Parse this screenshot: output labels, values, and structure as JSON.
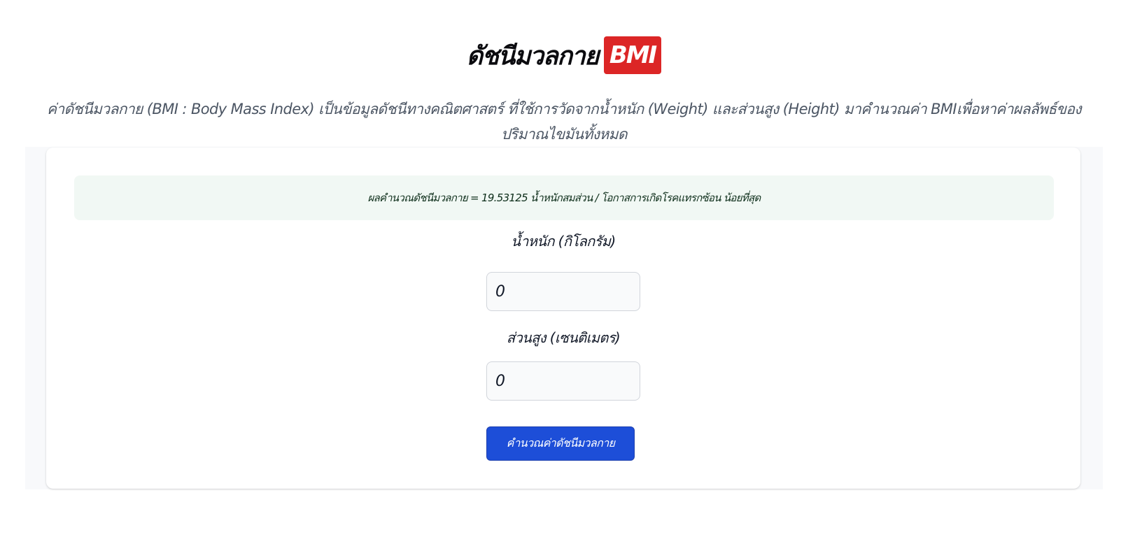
{
  "header": {
    "title": "ดัชนีมวลกาย",
    "badge": "BMI",
    "badge_color": "#dc2626",
    "description": "ค่าดัชนีมวลกาย (BMI : Body Mass Index) เป็นข้อมูลดัชนีทางคณิตศาสตร์ ที่ใช้การวัดจากน้ำหนัก (Weight) และส่วนสูง (Height) มาคำนวณค่า BMIเพื่อหาค่าผลลัพธ์ของปริมาณไขมันทั้งหมด"
  },
  "form": {
    "result_text": "ผลคำนวณดัชนีมวลกาย = 19.53125 น้ำหนักสมส่วน / โอกาสการเกิดโรคแทรกซ้อน น้อยที่สุด",
    "weight_label": "น้ำหนัก (กิโลกรัม)",
    "weight_value": "0",
    "height_label": "ส่วนสูง (เซนติเมตร)",
    "height_value": "0",
    "calculate_label": "คำนวณค่าดัชนีมวลกาย",
    "button_color": "#1d4ed8"
  }
}
